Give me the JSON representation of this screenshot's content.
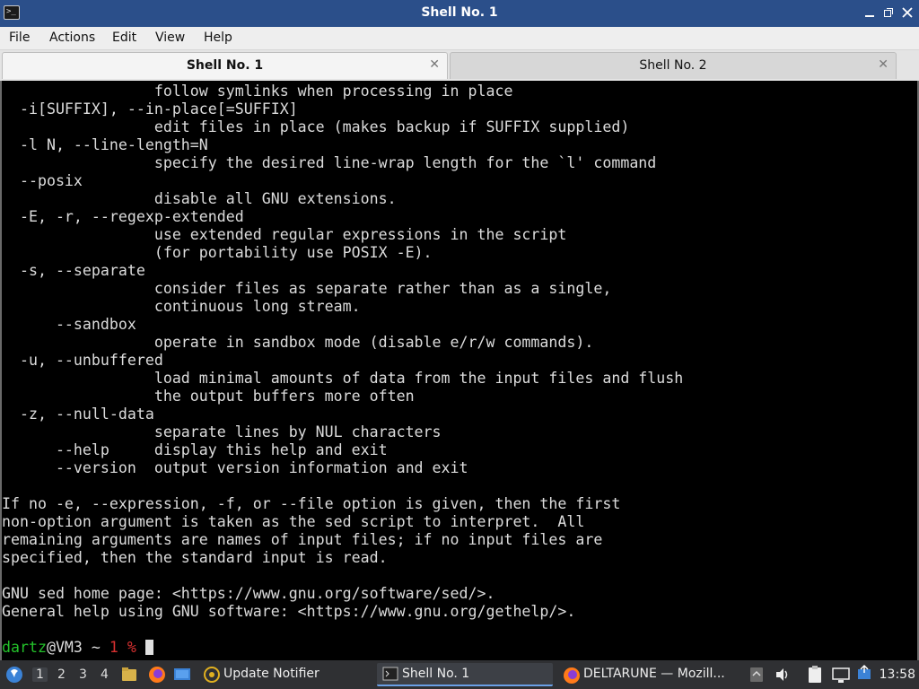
{
  "window": {
    "title": "Shell No. 1",
    "icon": "terminal-icon",
    "controls": [
      "minimize",
      "restore",
      "close"
    ]
  },
  "menu": {
    "items": [
      "File",
      "Actions",
      "Edit",
      "View",
      "Help"
    ]
  },
  "tabs": [
    {
      "label": "Shell No. 1",
      "active": true
    },
    {
      "label": "Shell No. 2",
      "active": false
    }
  ],
  "terminal": {
    "lines": [
      "                 follow symlinks when processing in place",
      "  -i[SUFFIX], --in-place[=SUFFIX]",
      "                 edit files in place (makes backup if SUFFIX supplied)",
      "  -l N, --line-length=N",
      "                 specify the desired line-wrap length for the `l' command",
      "  --posix",
      "                 disable all GNU extensions.",
      "  -E, -r, --regexp-extended",
      "                 use extended regular expressions in the script",
      "                 (for portability use POSIX -E).",
      "  -s, --separate",
      "                 consider files as separate rather than as a single,",
      "                 continuous long stream.",
      "      --sandbox",
      "                 operate in sandbox mode (disable e/r/w commands).",
      "  -u, --unbuffered",
      "                 load minimal amounts of data from the input files and flush",
      "                 the output buffers more often",
      "  -z, --null-data",
      "                 separate lines by NUL characters",
      "      --help     display this help and exit",
      "      --version  output version information and exit",
      "",
      "If no -e, --expression, -f, or --file option is given, then the first",
      "non-option argument is taken as the sed script to interpret.  All",
      "remaining arguments are names of input files; if no input files are",
      "specified, then the standard input is read.",
      "",
      "GNU sed home page: <https://www.gnu.org/software/sed/>.",
      "General help using GNU software: <https://www.gnu.org/gethelp/>.",
      ""
    ],
    "prompt": {
      "user": "dartz",
      "host_part": "@VM3 ~ ",
      "number": "1 %",
      "trailing": " "
    },
    "colors": {
      "background": "#000000",
      "foreground": "#dcdcdc",
      "prompt_user": "#23c02a",
      "prompt_number": "#d83030"
    }
  },
  "taskbar": {
    "desktops": [
      "1",
      "2",
      "3",
      "4"
    ],
    "active_desktop": "1",
    "tasks": [
      {
        "label": "Update Notifier",
        "icon": "update-notifier-icon",
        "active": false
      },
      {
        "label": "Shell No. 1",
        "icon": "terminal-icon",
        "active": true
      },
      {
        "label": "DELTARUNE — Mozill...",
        "icon": "firefox-icon",
        "active": false
      }
    ],
    "clock": "13:58",
    "accent": "#6aa0e6"
  }
}
